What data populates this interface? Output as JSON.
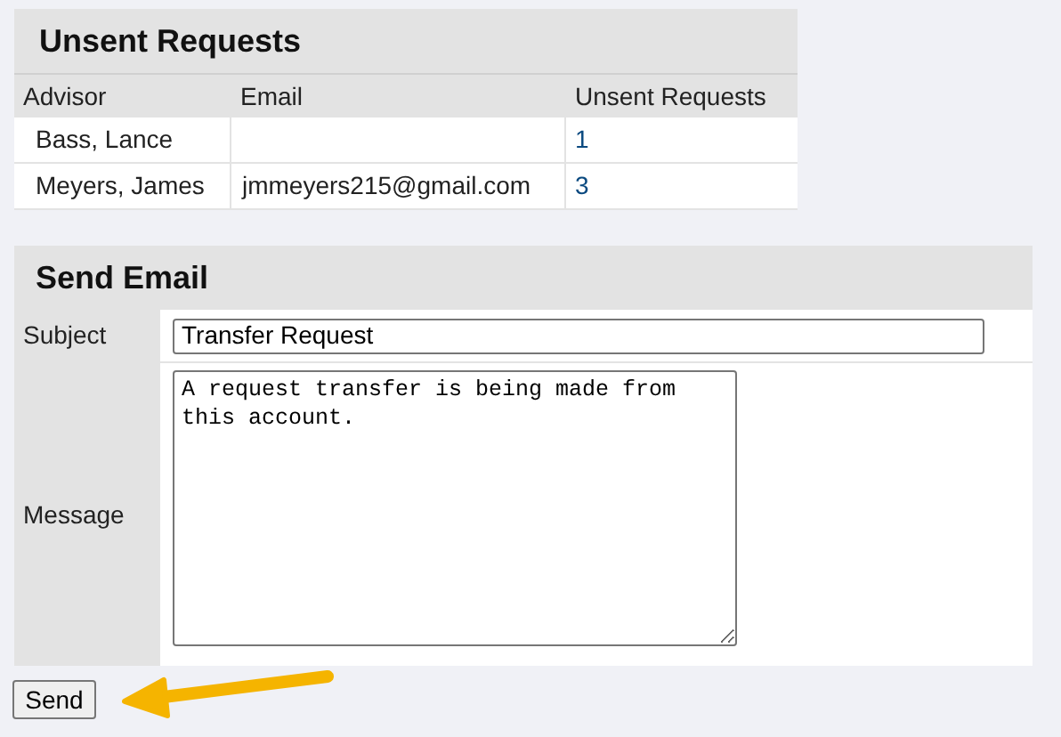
{
  "unsent_requests": {
    "title": "Unsent Requests",
    "columns": [
      "Advisor",
      "Email",
      "Unsent Requests"
    ],
    "rows": [
      {
        "advisor": "Bass, Lance",
        "email": "",
        "count": "1"
      },
      {
        "advisor": "Meyers, James",
        "email": "jmmeyers215@gmail.com",
        "count": "3"
      }
    ]
  },
  "send_email": {
    "title": "Send Email",
    "subject": {
      "label": "Subject",
      "value": "Transfer Request"
    },
    "message": {
      "label": "Message",
      "value": "A request transfer is being made from this account."
    },
    "button": "Send"
  }
}
